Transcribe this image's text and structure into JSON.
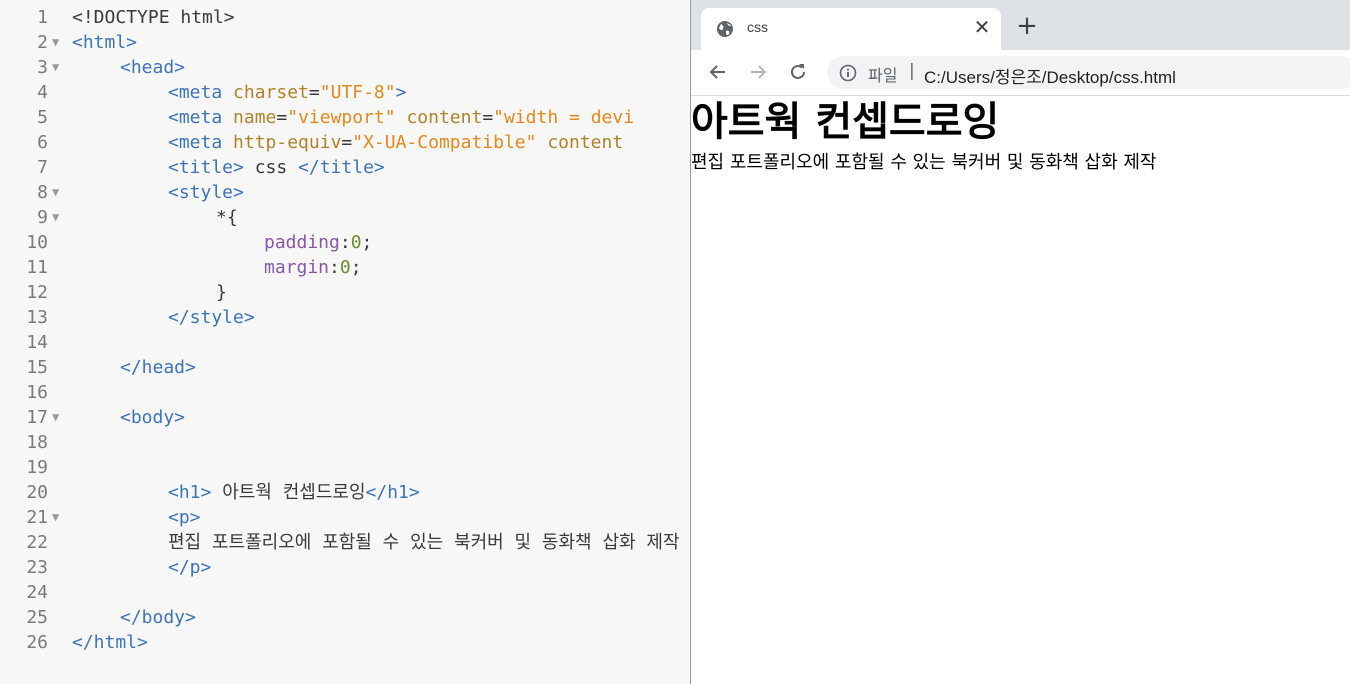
{
  "editor": {
    "lines": [
      {
        "n": "1",
        "fold": false,
        "indent": 0,
        "tokens": [
          {
            "t": "<!DOCTYPE html>",
            "c": "txt"
          }
        ]
      },
      {
        "n": "2",
        "fold": true,
        "indent": 0,
        "tokens": [
          {
            "t": "<html>",
            "c": "tag"
          }
        ]
      },
      {
        "n": "3",
        "fold": true,
        "indent": 4,
        "tokens": [
          {
            "t": "<head>",
            "c": "tag"
          }
        ]
      },
      {
        "n": "4",
        "fold": false,
        "indent": 8,
        "tokens": [
          {
            "t": "<meta ",
            "c": "tag"
          },
          {
            "t": "charset",
            "c": "attr"
          },
          {
            "t": "=",
            "c": "punc"
          },
          {
            "t": "\"UTF-8\"",
            "c": "val"
          },
          {
            "t": ">",
            "c": "tag"
          }
        ]
      },
      {
        "n": "5",
        "fold": false,
        "indent": 8,
        "tokens": [
          {
            "t": "<meta ",
            "c": "tag"
          },
          {
            "t": "name",
            "c": "attr"
          },
          {
            "t": "=",
            "c": "punc"
          },
          {
            "t": "\"viewport\"",
            "c": "val"
          },
          {
            "t": " content",
            "c": "attr"
          },
          {
            "t": "=",
            "c": "punc"
          },
          {
            "t": "\"width = devi",
            "c": "val"
          }
        ]
      },
      {
        "n": "6",
        "fold": false,
        "indent": 8,
        "tokens": [
          {
            "t": "<meta ",
            "c": "tag"
          },
          {
            "t": "http-equiv",
            "c": "attr"
          },
          {
            "t": "=",
            "c": "punc"
          },
          {
            "t": "\"X-UA-Compatible\"",
            "c": "val"
          },
          {
            "t": " content ",
            "c": "attr"
          }
        ]
      },
      {
        "n": "7",
        "fold": false,
        "indent": 8,
        "tokens": [
          {
            "t": "<title>",
            "c": "tag"
          },
          {
            "t": " css ",
            "c": "txt"
          },
          {
            "t": "</title>",
            "c": "tag"
          }
        ]
      },
      {
        "n": "8",
        "fold": true,
        "indent": 8,
        "tokens": [
          {
            "t": "<style>",
            "c": "tag"
          }
        ]
      },
      {
        "n": "9",
        "fold": true,
        "indent": 12,
        "tokens": [
          {
            "t": "*{",
            "c": "punc"
          }
        ]
      },
      {
        "n": "10",
        "fold": false,
        "indent": 16,
        "tokens": [
          {
            "t": "padding",
            "c": "prop"
          },
          {
            "t": ":",
            "c": "punc"
          },
          {
            "t": "0",
            "c": "num"
          },
          {
            "t": ";",
            "c": "punc"
          }
        ]
      },
      {
        "n": "11",
        "fold": false,
        "indent": 16,
        "tokens": [
          {
            "t": "margin",
            "c": "prop"
          },
          {
            "t": ":",
            "c": "punc"
          },
          {
            "t": "0",
            "c": "num"
          },
          {
            "t": ";",
            "c": "punc"
          }
        ]
      },
      {
        "n": "12",
        "fold": false,
        "indent": 12,
        "tokens": [
          {
            "t": "}",
            "c": "punc"
          }
        ]
      },
      {
        "n": "13",
        "fold": false,
        "indent": 8,
        "tokens": [
          {
            "t": "</style>",
            "c": "tag"
          }
        ]
      },
      {
        "n": "14",
        "fold": false,
        "indent": 0,
        "tokens": []
      },
      {
        "n": "15",
        "fold": false,
        "indent": 4,
        "tokens": [
          {
            "t": "</head>",
            "c": "tag"
          }
        ]
      },
      {
        "n": "16",
        "fold": false,
        "indent": 0,
        "tokens": []
      },
      {
        "n": "17",
        "fold": true,
        "indent": 4,
        "tokens": [
          {
            "t": "<body>",
            "c": "tag"
          }
        ]
      },
      {
        "n": "18",
        "fold": false,
        "indent": 0,
        "tokens": []
      },
      {
        "n": "19",
        "fold": false,
        "indent": 0,
        "tokens": []
      },
      {
        "n": "20",
        "fold": false,
        "indent": 8,
        "tokens": [
          {
            "t": "<h1>",
            "c": "tag"
          },
          {
            "t": " 아트웍 컨셉드로잉",
            "c": "txt"
          },
          {
            "t": "</h1>",
            "c": "tag"
          }
        ]
      },
      {
        "n": "21",
        "fold": true,
        "indent": 8,
        "tokens": [
          {
            "t": "<p>",
            "c": "tag"
          }
        ]
      },
      {
        "n": "22",
        "fold": false,
        "indent": 8,
        "tokens": [
          {
            "t": "편집 포트폴리오에 포함될 수 있는 북커버 및 동화책 삽화 제작",
            "c": "txt"
          }
        ]
      },
      {
        "n": "23",
        "fold": false,
        "indent": 8,
        "tokens": [
          {
            "t": "</p>",
            "c": "tag"
          }
        ]
      },
      {
        "n": "24",
        "fold": false,
        "indent": 0,
        "tokens": []
      },
      {
        "n": "25",
        "fold": false,
        "indent": 4,
        "tokens": [
          {
            "t": "</body>",
            "c": "tag"
          }
        ]
      },
      {
        "n": "26",
        "fold": false,
        "indent": 0,
        "tokens": [
          {
            "t": "</html>",
            "c": "tag"
          }
        ]
      }
    ],
    "fold_glyph": "▼",
    "colors": {
      "tag": "#3f73b8",
      "attr": "#b0822a",
      "value": "#e6871c",
      "property": "#8a57a8",
      "number": "#6c8c2c",
      "text": "#3a3a3a",
      "background": "#f7f7f7"
    }
  },
  "browser": {
    "tab": {
      "title": "css",
      "favicon": "globe-icon",
      "close_label": "✕"
    },
    "new_tab_label": "+",
    "toolbar": {
      "back": "back-arrow-icon",
      "forward": "forward-arrow-icon",
      "reload": "reload-icon"
    },
    "omnibox": {
      "scheme_label": "파일",
      "separator": "|",
      "url": "C:/Users/정은조/Desktop/css.html",
      "info_icon": "info-icon"
    },
    "page": {
      "h1": "아트웍 컨셉드로잉",
      "p": "편집 포트폴리오에 포함될 수 있는 북커버 및 동화책 삽화 제작"
    },
    "colors": {
      "tabstrip": "#dee1e6",
      "omnibox": "#f1f3f4",
      "icon": "#5f6368"
    }
  }
}
